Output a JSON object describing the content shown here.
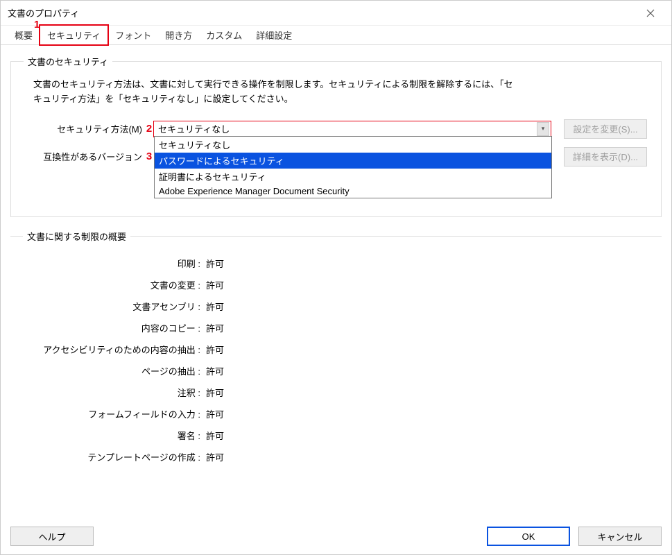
{
  "window": {
    "title": "文書のプロパティ"
  },
  "tabs": [
    {
      "label": "概要"
    },
    {
      "label": "セキュリティ"
    },
    {
      "label": "フォント"
    },
    {
      "label": "開き方"
    },
    {
      "label": "カスタム"
    },
    {
      "label": "詳細設定"
    }
  ],
  "activeTab": "セキュリティ",
  "annotations": {
    "a1": "1",
    "a2": "2",
    "a3": "3"
  },
  "security": {
    "legend": "文書のセキュリティ",
    "desc1": "文書のセキュリティ方法は、文書に対して実行できる操作を制限します。セキュリティによる制限を解除するには、「セ",
    "desc2": "キュリティ方法」を「セキュリティなし」に設定してください。",
    "methodLabel": "セキュリティ方法(M)",
    "methodSelected": "セキュリティなし",
    "compatLabel": "互換性があるバージョン",
    "changeBtn": "設定を変更(S)...",
    "detailBtn": "詳細を表示(D)...",
    "options": [
      "セキュリティなし",
      "パスワードによるセキュリティ",
      "証明書によるセキュリティ",
      "Adobe Experience Manager Document Security"
    ]
  },
  "perms": {
    "legend": "文書に関する制限の概要",
    "rows": [
      {
        "label": "印刷 :",
        "val": "許可"
      },
      {
        "label": "文書の変更 :",
        "val": "許可"
      },
      {
        "label": "文書アセンブリ :",
        "val": "許可"
      },
      {
        "label": "内容のコピー :",
        "val": "許可"
      },
      {
        "label": "アクセシビリティのための内容の抽出 :",
        "val": "許可"
      },
      {
        "label": "ページの抽出 :",
        "val": "許可"
      },
      {
        "label": "注釈 :",
        "val": "許可"
      },
      {
        "label": "フォームフィールドの入力 :",
        "val": "許可"
      },
      {
        "label": "署名 :",
        "val": "許可"
      },
      {
        "label": "テンプレートページの作成 :",
        "val": "許可"
      }
    ]
  },
  "footer": {
    "help": "ヘルプ",
    "ok": "OK",
    "cancel": "キャンセル"
  }
}
